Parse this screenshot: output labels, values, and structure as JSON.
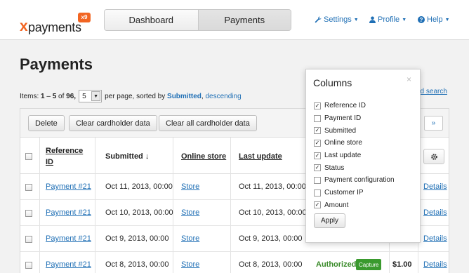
{
  "brand": {
    "logo_text": "payments",
    "logo_x": "x",
    "logo_badge": "x9"
  },
  "nav": {
    "tabs": [
      {
        "label": "Dashboard"
      },
      {
        "label": "Payments"
      }
    ]
  },
  "topmenu": {
    "settings": "Settings",
    "profile": "Profile",
    "help": "Help"
  },
  "page": {
    "title": "Payments",
    "items_prefix": "Items:",
    "items_from": "1",
    "items_dash": "–",
    "items_to": "5",
    "items_of": "of",
    "items_total": "96,",
    "per_page_value": "5",
    "per_page_text": "per page, sorted by",
    "sort_field": "Submitted",
    "sort_order": "descending",
    "advanced_search": "ed search"
  },
  "toolbar": {
    "delete": "Delete",
    "clear_cardholder": "Clear cardholder data",
    "clear_all_cardholder": "Clear all cardholder data",
    "next": "»"
  },
  "table": {
    "headers": {
      "reference_id_1": "Reference",
      "reference_id_2": "ID",
      "submitted": "Submitted ↓",
      "online_store": "Online store",
      "last_update": "Last update"
    },
    "rows": [
      {
        "ref": "Payment #21",
        "submitted": "Oct 11, 2013, 00:00",
        "store": "Store",
        "last_update": "Oct 11, 2013, 00:00",
        "details": "Details"
      },
      {
        "ref": "Payment #21",
        "submitted": "Oct 10, 2013, 00:00",
        "store": "Store",
        "last_update": "Oct 10, 2013, 00:00",
        "details": "Details"
      },
      {
        "ref": "Payment #21",
        "submitted": "Oct 9, 2013, 00:00",
        "store": "Store",
        "last_update": "Oct 9, 2013, 00:00",
        "details": "Details"
      },
      {
        "ref": "Payment #21",
        "submitted": "Oct 8, 2013, 00:00",
        "store": "Store",
        "last_update": "Oct 8, 2013, 00:00",
        "status": "Authorized",
        "capture": "Capture",
        "amount": "$1.00",
        "details": "Details"
      }
    ]
  },
  "columns_popup": {
    "title": "Columns",
    "close": "×",
    "apply": "Apply",
    "items": [
      {
        "label": "Reference ID",
        "checked": true
      },
      {
        "label": "Payment ID",
        "checked": false
      },
      {
        "label": "Submitted",
        "checked": true
      },
      {
        "label": "Online store",
        "checked": true
      },
      {
        "label": "Last update",
        "checked": true
      },
      {
        "label": "Status",
        "checked": true
      },
      {
        "label": "Payment configuration",
        "checked": false
      },
      {
        "label": "Customer IP",
        "checked": false
      },
      {
        "label": "Amount",
        "checked": true
      }
    ]
  },
  "icons": {
    "settings": "wrench-icon",
    "profile": "user-icon",
    "help": "help-circle-icon",
    "columns": "gear-icon"
  },
  "colors": {
    "accent": "#f26522",
    "link": "#1f6fb5",
    "status_ok": "#3a8b2a",
    "capture_bg": "#3a9a2e"
  }
}
